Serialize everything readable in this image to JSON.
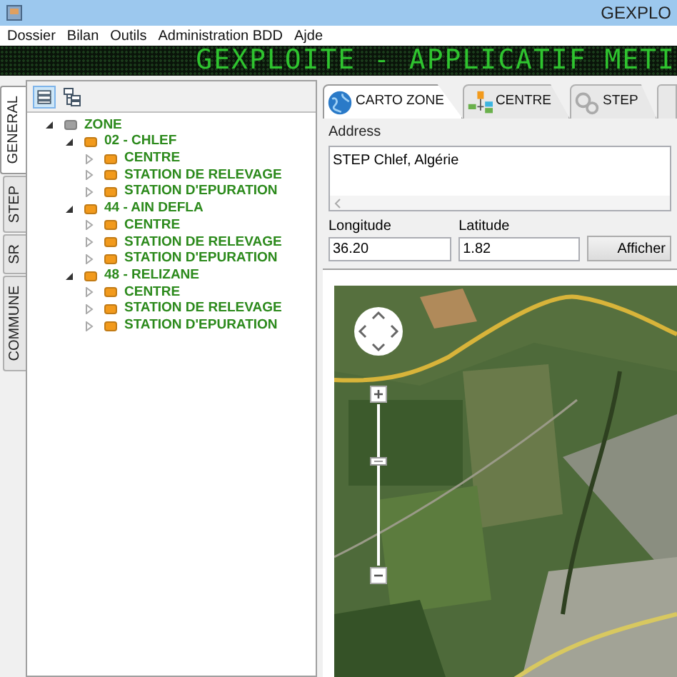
{
  "window": {
    "title": "GEXPLO"
  },
  "menu": [
    "Dossier",
    "Bilan",
    "Outils",
    "Administration BDD",
    "Ajde"
  ],
  "banner": "GEXPLOITE - APPLICATIF METI",
  "side_tabs": [
    {
      "label": "GENERAL",
      "selected": true
    },
    {
      "label": "STEP",
      "selected": false
    },
    {
      "label": "SR",
      "selected": false
    },
    {
      "label": "COMMUNE",
      "selected": false
    }
  ],
  "tree": [
    {
      "label": "ZONE",
      "expanded": true,
      "color": "#a0a0a0",
      "children": [
        {
          "label": "02 - CHLEF",
          "expanded": true,
          "color": "#f29a1c",
          "children": [
            {
              "label": "CENTRE",
              "expanded": false,
              "color": "#f29a1c"
            },
            {
              "label": "STATION DE RELEVAGE",
              "expanded": false,
              "color": "#f29a1c"
            },
            {
              "label": "STATION D'EPURATION",
              "expanded": false,
              "color": "#f29a1c"
            }
          ]
        },
        {
          "label": "44 - AIN DEFLA",
          "expanded": true,
          "color": "#f29a1c",
          "children": [
            {
              "label": "CENTRE",
              "expanded": false,
              "color": "#f29a1c"
            },
            {
              "label": "STATION DE RELEVAGE",
              "expanded": false,
              "color": "#f29a1c"
            },
            {
              "label": "STATION D'EPURATION",
              "expanded": false,
              "color": "#f29a1c"
            }
          ]
        },
        {
          "label": "48 - RELIZANE",
          "expanded": true,
          "color": "#f29a1c",
          "children": [
            {
              "label": "CENTRE",
              "expanded": false,
              "color": "#f29a1c"
            },
            {
              "label": "STATION DE RELEVAGE",
              "expanded": false,
              "color": "#f29a1c"
            },
            {
              "label": "STATION D'EPURATION",
              "expanded": false,
              "color": "#f29a1c"
            }
          ]
        }
      ]
    }
  ],
  "tabs": [
    {
      "label": "CARTO ZONE",
      "kind": "globe",
      "selected": true
    },
    {
      "label": "CENTRE",
      "kind": "network",
      "selected": false
    },
    {
      "label": "STEP",
      "kind": "gears",
      "selected": false
    },
    {
      "kind": "blank",
      "selected": false
    }
  ],
  "address": {
    "label": "Address",
    "value": "STEP Chlef, Algérie"
  },
  "longitude": {
    "label": "Longitude",
    "value": "36.20"
  },
  "latitude": {
    "label": "Latitude",
    "value": "1.82"
  },
  "show_button": "Afficher",
  "map": {
    "kind": "picture",
    "zoom": {
      "level": 0.65
    }
  }
}
